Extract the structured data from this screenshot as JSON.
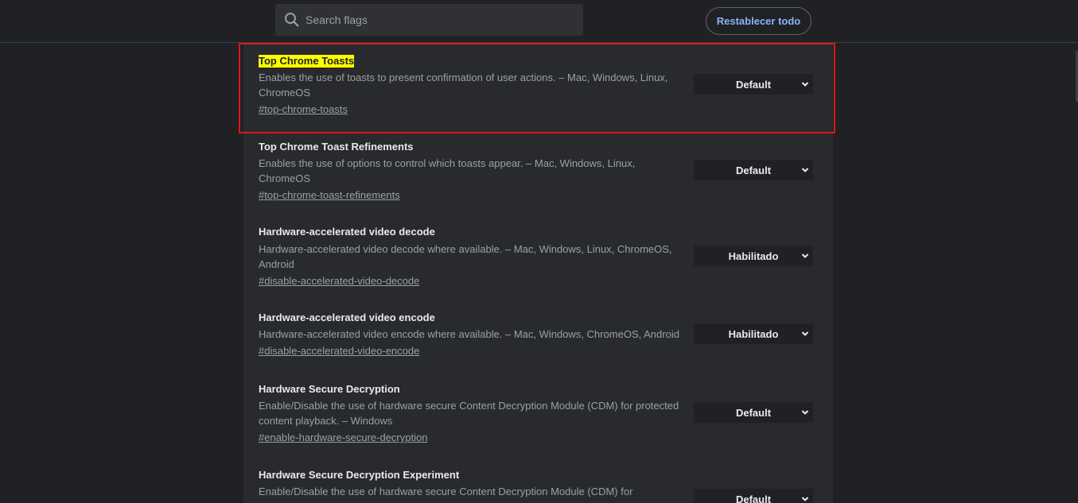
{
  "search": {
    "placeholder": "Search flags"
  },
  "header": {
    "reset_label": "Restablecer todo"
  },
  "flags": [
    {
      "title": "Top Chrome Toasts",
      "description": "Enables the use of toasts to present confirmation of user actions. – Mac, Windows, Linux, ChromeOS",
      "link": "#top-chrome-toasts",
      "value": "Default"
    },
    {
      "title": "Top Chrome Toast Refinements",
      "description": "Enables the use of options to control which toasts appear. – Mac, Windows, Linux, ChromeOS",
      "link": "#top-chrome-toast-refinements",
      "value": "Default"
    },
    {
      "title": "Hardware-accelerated video decode",
      "description": "Hardware-accelerated video decode where available. – Mac, Windows, Linux, ChromeOS, Android",
      "link": "#disable-accelerated-video-decode",
      "value": "Habilitado"
    },
    {
      "title": "Hardware-accelerated video encode",
      "description": "Hardware-accelerated video encode where available. – Mac, Windows, ChromeOS, Android",
      "link": "#disable-accelerated-video-encode",
      "value": "Habilitado"
    },
    {
      "title": "Hardware Secure Decryption",
      "description": "Enable/Disable the use of hardware secure Content Decryption Module (CDM) for protected content playback. – Windows",
      "link": "#enable-hardware-secure-decryption",
      "value": "Default"
    },
    {
      "title": "Hardware Secure Decryption Experiment",
      "description": "Enable/Disable the use of hardware secure Content Decryption Module (CDM) for",
      "link": "",
      "value": "Default"
    }
  ],
  "colors": {
    "highlight": "#ffff00",
    "annotation_box": "#e0141b",
    "accent": "#8ab4f8"
  }
}
